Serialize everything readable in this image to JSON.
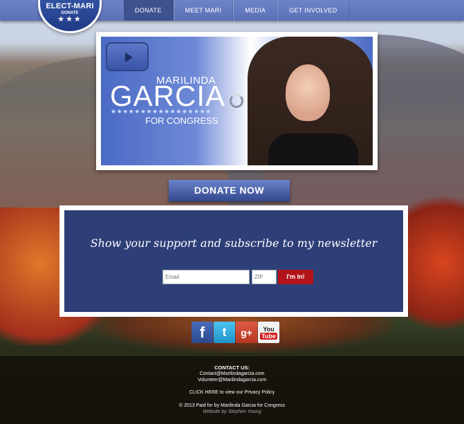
{
  "badge": {
    "title": "ELECT-MARI",
    "subtitle": "DONATE",
    "stars": "★★★"
  },
  "nav": {
    "items": [
      {
        "label": "DONATE",
        "active": true
      },
      {
        "label": "MEET MARI",
        "active": false
      },
      {
        "label": "MEDIA",
        "active": false
      },
      {
        "label": "GET INVOLVED",
        "active": false
      }
    ]
  },
  "hero": {
    "first_name": "MARILINDA",
    "last_name": "GARCIA",
    "stars": "★★★★★★★★★★★★★★★★★",
    "subtitle": "FOR CONGRESS"
  },
  "donate_button": "DONATE NOW",
  "newsletter": {
    "title": "Show your support and subscribe to my newsletter",
    "email_placeholder": "Email",
    "zip_placeholder": "ZIP",
    "submit_label": "I'm In!"
  },
  "social": {
    "facebook": "f",
    "twitter": "t",
    "googleplus": "g+",
    "youtube_top": "You",
    "youtube_bottom": "Tube"
  },
  "footer": {
    "contact_heading": "CONTACT US:",
    "contact_email_1": "Contact@Marilindagarcia.com",
    "contact_email_2": "Volunteer@Marilindagarcia.com",
    "privacy_text": "CLICK HERE to view our Privacy Policy",
    "copyright": "© 2013 Paid for by Marilinda Garcia for Congress",
    "credit": "Website by Stephen Young"
  },
  "colors": {
    "nav_bg": "#5a6fb6",
    "nav_active": "#3e528f",
    "panel_bg": "#2e3f78",
    "submit_red": "#b3141b"
  }
}
